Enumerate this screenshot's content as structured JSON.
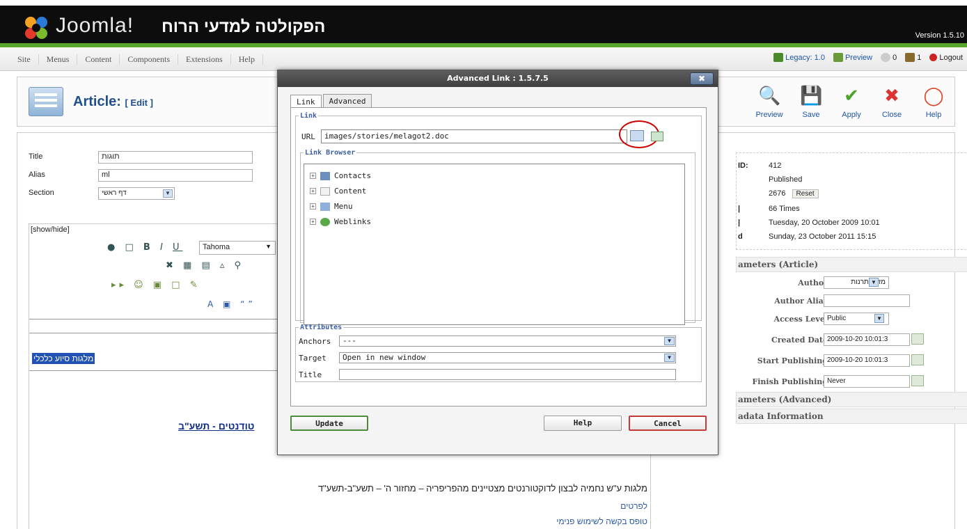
{
  "header": {
    "brand": "Joomla!",
    "site_title": "הפקולטה למדעי הרוח",
    "version": "Version 1.5.10"
  },
  "menubar": {
    "items": [
      "Site",
      "Menus",
      "Content",
      "Components",
      "Extensions",
      "Help"
    ],
    "legacy": "Legacy: 1.0",
    "preview": "Preview",
    "messages_count": "0",
    "users_count": "1",
    "logout": "Logout"
  },
  "toolbar": {
    "title": "Article:",
    "title_suffix": "[ Edit ]",
    "buttons": [
      "Preview",
      "Save",
      "Apply",
      "Close",
      "Help"
    ]
  },
  "form": {
    "title_label": "Title",
    "title_value": "תוגות",
    "alias_label": "Alias",
    "alias_value": "ml",
    "section_label": "Section",
    "section_value": "דף ראשי"
  },
  "editor": {
    "showhide": "[show/hide]",
    "font": "Tahoma",
    "highlighted_text": "מלגות סיוע כלכלי",
    "underlined_link": "טודנטים - תשע\"ב",
    "line1": "מלגות ע\"ש נחמיה לבצון לדוקטורנטים מצטיינים מהפריפריה – מחזור ה' – תשע\"ב-תשע\"ד",
    "line2": "לפרטים",
    "line3": "טופס בקשה לשימוש פנימי"
  },
  "info": {
    "id_label": "ID:",
    "id_value": "412",
    "state_value": "Published",
    "hits_value": "2676",
    "reset_label": "Reset",
    "revised_value": "66 Times",
    "created_value": "Tuesday, 20 October 2009 10:01",
    "modified_label": "d",
    "modified_value": "Sunday, 23 October 2011 15:15"
  },
  "params": {
    "header": "ameters (Article)",
    "author_label": "Author",
    "author_value": "מזרע תרנות",
    "author_alias_label": "Author Alias",
    "author_alias_value": "",
    "access_label": "Access Level",
    "access_value": "Public",
    "created_label": "Created Date",
    "created_value": "2009-10-20 10:01:3",
    "start_label": "Start Publishing",
    "start_value": "2009-10-20 10:01:3",
    "finish_label": "Finish Publishing",
    "finish_value": "Never",
    "advanced_header": "ameters (Advanced)",
    "metadata_header": "adata Information"
  },
  "modal": {
    "title": "Advanced Link : 1.5.7.5",
    "close": "✖",
    "tabs": [
      "Link",
      "Advanced"
    ],
    "link_legend": "Link",
    "url_label": "URL",
    "url_value": "images/stories/melagot2.doc",
    "browser_legend": "Link Browser",
    "tree": [
      "Contacts",
      "Content",
      "Menu",
      "Weblinks"
    ],
    "attributes_legend": "Attributes",
    "anchors_label": "Anchors",
    "anchors_value": "---",
    "target_label": "Target",
    "target_value": "Open in new window",
    "title_label": "Title",
    "title_value": "",
    "update_label": "Update",
    "help_label": "Help",
    "cancel_label": "Cancel"
  },
  "colors": {
    "accent_blue": "#1f4f8c",
    "joomla_green": "#58a52c",
    "cancel_red": "#c23a3a",
    "highlight": "#2152b4"
  }
}
